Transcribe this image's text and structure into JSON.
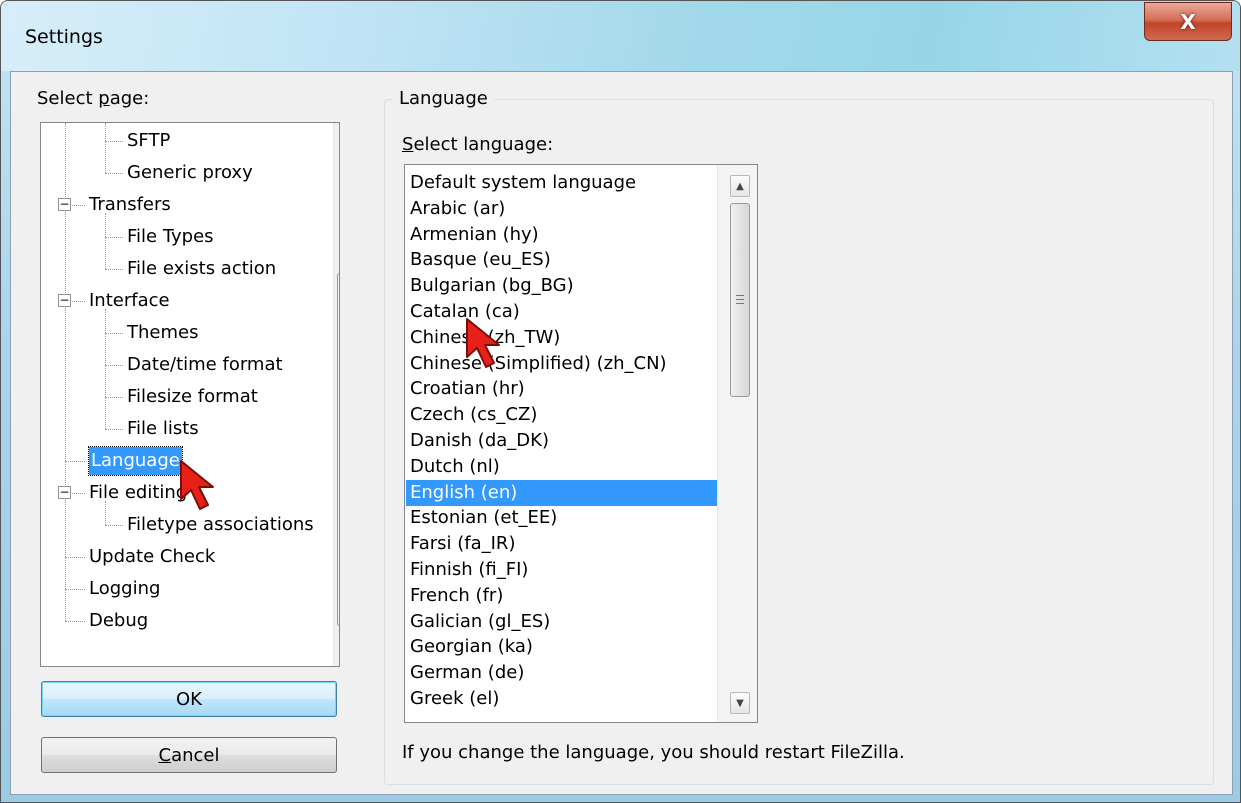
{
  "window": {
    "title": "Settings",
    "close_glyph": "X"
  },
  "left": {
    "select_page_label": "Select page:",
    "tree": [
      {
        "label": "SFTP",
        "level": 2
      },
      {
        "label": "Generic proxy",
        "level": 2
      },
      {
        "label": "Transfers",
        "level": 1,
        "expander": "−"
      },
      {
        "label": "File Types",
        "level": 2
      },
      {
        "label": "File exists action",
        "level": 2
      },
      {
        "label": "Interface",
        "level": 1,
        "expander": "−"
      },
      {
        "label": "Themes",
        "level": 2
      },
      {
        "label": "Date/time format",
        "level": 2
      },
      {
        "label": "Filesize format",
        "level": 2
      },
      {
        "label": "File lists",
        "level": 2
      },
      {
        "label": "Language",
        "level": 1,
        "selected": true
      },
      {
        "label": "File editing",
        "level": 1,
        "expander": "−"
      },
      {
        "label": "Filetype associations",
        "level": 2
      },
      {
        "label": "Update Check",
        "level": 1
      },
      {
        "label": "Logging",
        "level": 1
      },
      {
        "label": "Debug",
        "level": 1
      }
    ],
    "ok_label": "OK",
    "cancel_label": "Cancel"
  },
  "right": {
    "group_title": "Language",
    "select_language_label": "Select language:",
    "languages": [
      "Default system language",
      "Arabic (ar)",
      "Armenian (hy)",
      "Basque (eu_ES)",
      "Bulgarian (bg_BG)",
      "Catalan (ca)",
      "Chinese (zh_TW)",
      "Chinese (Simplified) (zh_CN)",
      "Croatian (hr)",
      "Czech (cs_CZ)",
      "Danish (da_DK)",
      "Dutch (nl)",
      "English (en)",
      "Estonian (et_EE)",
      "Farsi (fa_IR)",
      "Finnish (fi_FI)",
      "French (fr)",
      "Galician (gl_ES)",
      "Georgian (ka)",
      "German (de)",
      "Greek (el)"
    ],
    "selected_language": "English (en)",
    "restart_note": "If you change the language, you should restart FileZilla."
  },
  "colors": {
    "selection": "#3399ff",
    "annotation_arrow": "#e8201a"
  },
  "icons": {
    "scroll_up": "up-arrow-icon",
    "scroll_down": "down-arrow-icon",
    "cursor": "mouse-cursor-icon"
  }
}
